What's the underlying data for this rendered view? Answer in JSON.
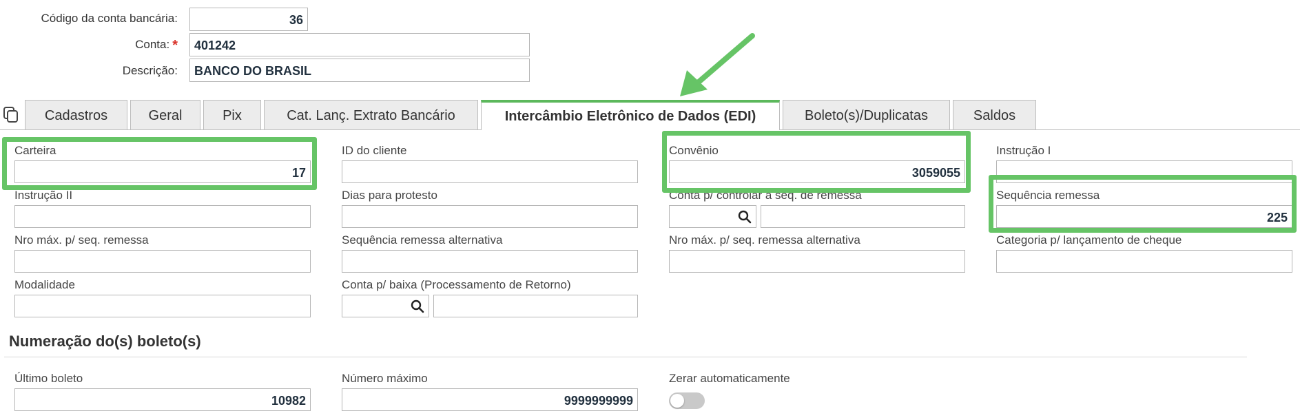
{
  "header": {
    "codigo_label": "Código da conta bancária:",
    "codigo_value": "36",
    "conta_label": "Conta:",
    "conta_required": "*",
    "conta_value": "401242",
    "descricao_label": "Descrição:",
    "descricao_value": "BANCO DO BRASIL"
  },
  "tabs": [
    {
      "label": "Cadastros"
    },
    {
      "label": "Geral"
    },
    {
      "label": "Pix"
    },
    {
      "label": "Cat. Lanç. Extrato Bancário"
    },
    {
      "label": "Intercâmbio Eletrônico de Dados (EDI)",
      "active": true
    },
    {
      "label": "Boleto(s)/Duplicatas"
    },
    {
      "label": "Saldos"
    }
  ],
  "fields": {
    "carteira": {
      "label": "Carteira",
      "value": "17"
    },
    "id_cliente": {
      "label": "ID do cliente",
      "value": ""
    },
    "convenio": {
      "label": "Convênio",
      "value": "3059055"
    },
    "instrucao1": {
      "label": "Instrução I",
      "value": ""
    },
    "instrucao2": {
      "label": "Instrução II",
      "value": ""
    },
    "dias_protesto": {
      "label": "Dias para protesto",
      "value": ""
    },
    "conta_seq_remessa": {
      "label": "Conta p/ controlar a seq. de remessa",
      "value": ""
    },
    "sequencia_remessa": {
      "label": "Sequência remessa",
      "value": "225"
    },
    "nro_max_seq": {
      "label": "Nro máx. p/ seq. remessa",
      "value": ""
    },
    "seq_remessa_alt": {
      "label": "Sequência remessa alternativa",
      "value": ""
    },
    "nro_max_seq_alt": {
      "label": "Nro máx. p/ seq. remessa alternativa",
      "value": ""
    },
    "categoria_cheque": {
      "label": "Categoria p/ lançamento de cheque",
      "value": ""
    },
    "modalidade": {
      "label": "Modalidade",
      "value": ""
    },
    "conta_baixa": {
      "label": "Conta p/ baixa (Processamento de Retorno)",
      "value": ""
    }
  },
  "numeracao": {
    "title": "Numeração do(s) boleto(s)",
    "ultimo_label": "Último boleto",
    "ultimo_value": "10982",
    "maximo_label": "Número máximo",
    "maximo_value": "9999999999",
    "zerar_label": "Zerar automaticamente",
    "zerar_on": false
  },
  "colors": {
    "highlight": "#66c466",
    "required": "#d9342b"
  },
  "icons": [
    "copy-icon",
    "search-icon",
    "arrow-annotation"
  ]
}
